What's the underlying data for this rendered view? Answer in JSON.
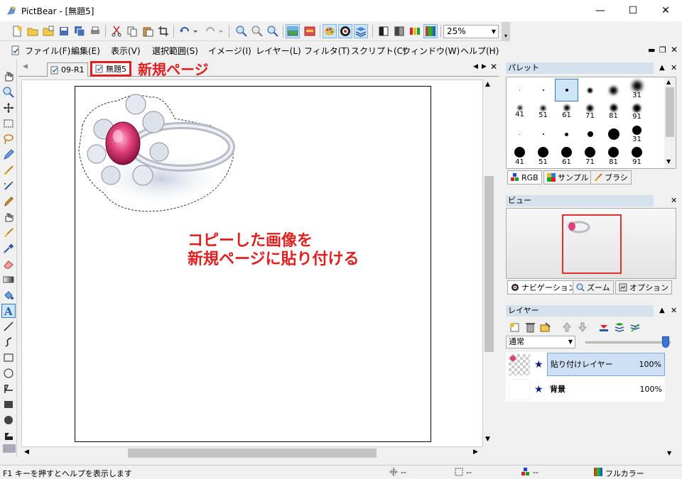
{
  "window": {
    "title": "PictBear - [無題5]",
    "minimize": "—",
    "maximize": "☐",
    "close": "✕"
  },
  "toolbar": {
    "zoom": "25%"
  },
  "menu": [
    "ファイル(F)",
    "編集(E)",
    "表示(V)",
    "選択範囲(S)",
    "イメージ(I)",
    "レイヤー(L)",
    "フィルタ(T)",
    "スクリプト(C)",
    "ウィンドウ(W)",
    "ヘルプ(H)"
  ],
  "tabs": [
    {
      "label": "09-R1"
    },
    {
      "label": "無題5"
    }
  ],
  "annotations": {
    "new_page": "新規ページ",
    "paste_line1": "コピーした画像を",
    "paste_line2": "新規ページに貼り付ける"
  },
  "panels": {
    "palette": {
      "title": "パレット",
      "brushes": [
        "",
        "",
        "",
        "",
        "",
        "31",
        "41",
        "51",
        "61",
        "71",
        "81",
        "91",
        "",
        "",
        "",
        "",
        "",
        "31",
        "41",
        "51",
        "61",
        "71",
        "81",
        "91"
      ],
      "tabs": [
        "RGB",
        "サンプル",
        "ブラシ"
      ]
    },
    "view": {
      "title": "ビュー",
      "tabs": [
        "ナビゲーション",
        "ズーム",
        "オプション"
      ]
    },
    "layers": {
      "title": "レイヤー",
      "blend_mode": "通常",
      "items": [
        {
          "name": "貼り付けレイヤー",
          "opacity": "100%"
        },
        {
          "name": "背景",
          "opacity": "100%"
        }
      ]
    }
  },
  "status": {
    "help": "F1 キーを押すとヘルプを表示します",
    "cursor": "--",
    "size": "--",
    "color_info": "--",
    "color_mode": "フルカラー"
  },
  "colors": {
    "annotation_red": "#e02020",
    "selection_blue": "#cde6f7",
    "panel_header": "#d6e1ee"
  }
}
